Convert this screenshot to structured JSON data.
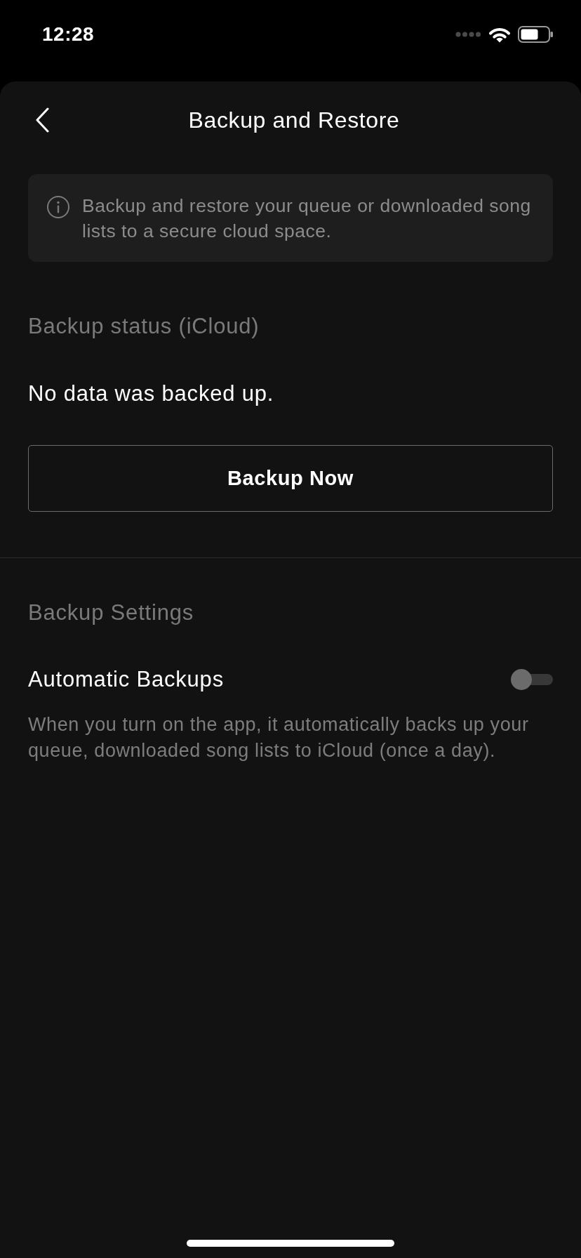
{
  "status_bar": {
    "time": "12:28"
  },
  "header": {
    "title": "Backup and Restore"
  },
  "info_notice": {
    "text": "Backup and restore your queue or downloaded song lists to a secure cloud space."
  },
  "backup_status": {
    "heading": "Backup status (iCloud)",
    "message": "No data was backed up.",
    "button": "Backup Now"
  },
  "backup_settings": {
    "heading": "Backup Settings",
    "items": [
      {
        "label": "Automatic Backups",
        "on": false,
        "description": "When you turn on the app, it automatically backs up your queue, downloaded song lists to iCloud (once a day)."
      }
    ]
  }
}
